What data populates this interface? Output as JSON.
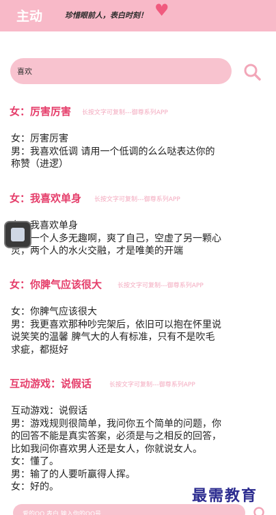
{
  "header": {
    "title": "主动",
    "slogan": "珍惜眼前人，表白时刻！",
    "heart_color": "#f05a7e"
  },
  "search": {
    "value": "喜欢",
    "icon": "search-icon"
  },
  "colors": {
    "accent": "#e53d6a",
    "header_bg": "#f8b9c8",
    "search_bg": "#f8c3cf"
  },
  "entries": [
    {
      "title": "女：厉害厉害",
      "hint": "长按文字可复制---御尊系列APP",
      "lines": [
        "女：厉害厉害",
        "男：我喜欢低调 请用一个低调的么么哒表达你的",
        "称赞（进逻）"
      ]
    },
    {
      "title": "女：我喜欢单身",
      "hint": "长按文字可复制---御尊系列APP",
      "lines": [
        "女：我喜欢单身",
        "男：一个人多无趣啊，爽了自己，空虚了另一颗心",
        "灵，两个人的水火交融，才是唯美的开端"
      ]
    },
    {
      "title": "女：你脾气应该很大",
      "hint": "长按文字可复制---御尊系列APP",
      "lines": [
        "女：你脾气应该很大",
        "男：我更喜欢那种吵完架后，依旧可以抱在怀里说",
        "说笑笑的温馨 脾气大的人有标准，只有不是吹毛",
        "求疵，都挺好"
      ]
    },
    {
      "title": "互动游戏：说假话",
      "hint": "长按文字可复制---御尊系列APP",
      "lines": [
        "互动游戏：说假话",
        "男：游戏规则很简单，我问你五个简单的问题，你",
        "的回答不能是真实答案，必须是与之相反的回答，",
        "比如我问你喜欢男人还是女人，你就说女人。",
        "女：懂了。",
        "男：输了的人要听赢得人挥。",
        "女：好的。"
      ]
    }
  ],
  "bottom_search": {
    "placeholder": "爱的QQ 表白 输入你的QQ号"
  },
  "watermark": "最需教育"
}
